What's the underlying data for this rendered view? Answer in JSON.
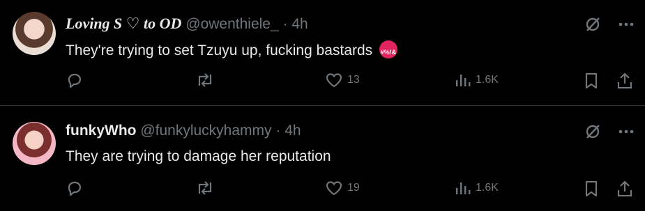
{
  "tweets": [
    {
      "display_name": "Loving S ♡ to OD",
      "handle": "@owenthiele_",
      "separator": "·",
      "time": "4h",
      "text": "They're trying to set Tzuyu up, fucking bastards",
      "emoji": "angry-face-icon",
      "likes": "13",
      "views": "1.6K"
    },
    {
      "display_name": "funkyWho",
      "handle": "@funkyluckyhammy",
      "separator": "·",
      "time": "4h",
      "text": "They are trying to damage her reputation",
      "likes": "19",
      "views": "1.6K"
    }
  ],
  "colors": {
    "background": "#000000",
    "text": "#e7e9ea",
    "muted": "#71767b",
    "divider": "#2f3336",
    "emoji": "#e0245e"
  }
}
